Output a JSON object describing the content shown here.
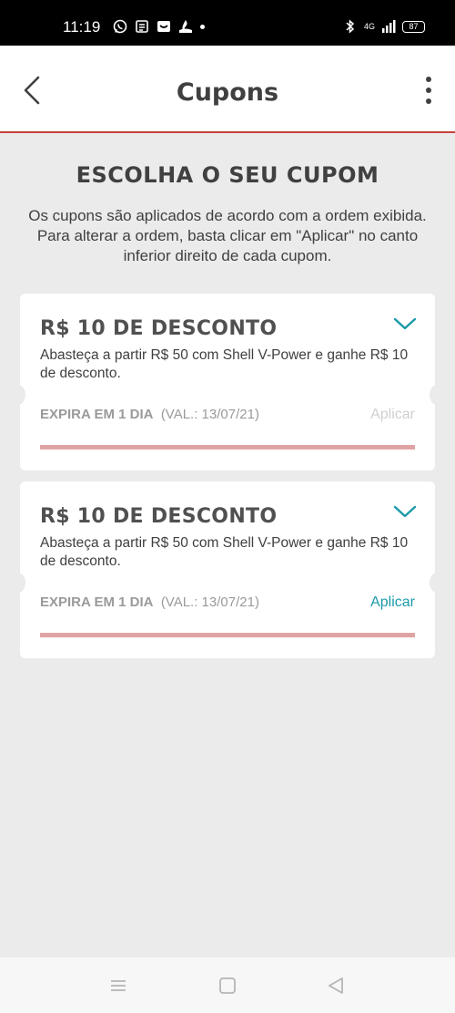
{
  "status_bar": {
    "time": "11:19",
    "left_icons": [
      "whatsapp-icon",
      "news-icon",
      "mail-icon",
      "santander-icon",
      "notification-dot"
    ],
    "network_label": "4G",
    "battery": "87"
  },
  "header": {
    "title": "Cupons"
  },
  "main": {
    "heading": "ESCOLHA O SEU CUPOM",
    "description": "Os cupons são aplicados de acordo com a ordem exibida. Para alterar a ordem, basta clicar em \"Aplicar\" no canto inferior direito de cada cupom."
  },
  "coupons": [
    {
      "title": "R$ 10 DE DESCONTO",
      "description": "Abasteça a partir R$ 50 com Shell V-Power e ganhe R$ 10 de desconto.",
      "expira": "EXPIRA EM 1 DIA",
      "validade": "(VAL.: 13/07/21)",
      "apply_label": "Aplicar",
      "apply_enabled": false
    },
    {
      "title": "R$ 10 DE DESCONTO",
      "description": "Abasteça a partir R$ 50 com Shell V-Power e ganhe R$ 10 de desconto.",
      "expira": "EXPIRA EM 1 DIA",
      "validade": "(VAL.: 13/07/21)",
      "apply_label": "Aplicar",
      "apply_enabled": true
    }
  ],
  "colors": {
    "accent_red": "#c9423a",
    "accent_teal": "#1b9aaa",
    "progress_bar": "#e0a3a3"
  },
  "nav_bar": [
    "menu-icon",
    "home-square-icon",
    "back-triangle-icon"
  ]
}
